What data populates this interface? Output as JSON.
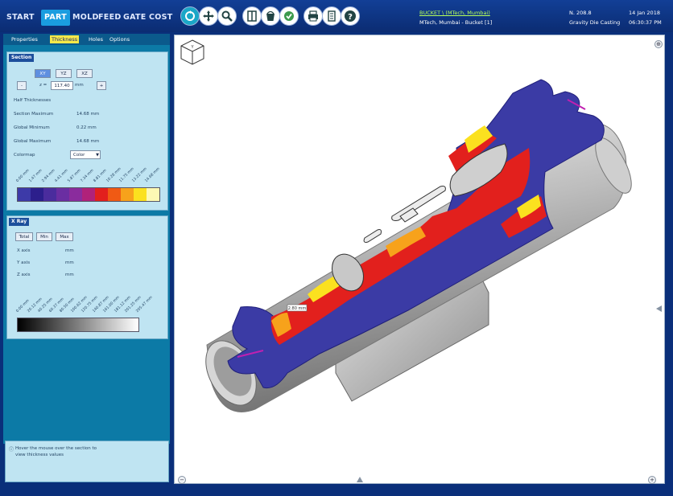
{
  "tabs": [
    {
      "id": "start",
      "label": "START"
    },
    {
      "id": "part",
      "label": "PART",
      "active": true
    },
    {
      "id": "mold",
      "label": "MOLD"
    },
    {
      "id": "feed",
      "label": "FEED"
    },
    {
      "id": "gate",
      "label": "GATE"
    },
    {
      "id": "cost",
      "label": "COST"
    }
  ],
  "toolbar": {
    "icons": [
      "rotate-icon",
      "pan-icon",
      "zoom-icon",
      "section-icon",
      "bucket-icon",
      "check-icon",
      "print-icon",
      "document-icon",
      "help-icon"
    ]
  },
  "header": {
    "project_link": "BUCKET \\ (MTech, Mumbai)",
    "project_sub": "MTech, Mumbai - Bucket [1]",
    "id_value": "N. 208.8",
    "date": "14 Jan 2018",
    "process": "Gravity Die Casting",
    "time": "06:30:37 PM"
  },
  "subtabs": [
    {
      "label": "Properties"
    },
    {
      "label": "Thickness",
      "active": true
    },
    {
      "label": "Holes"
    },
    {
      "label": "Options"
    }
  ],
  "section": {
    "title": "Section",
    "axes": [
      "XY",
      "YZ",
      "XZ"
    ],
    "minus": "-",
    "plus": "+",
    "z_label": "z =",
    "z_value": "117.40",
    "z_unit": "mm",
    "half_label": "Half Thicknesses",
    "rows": [
      {
        "label": "Section Maximum",
        "value": "14.68 mm"
      },
      {
        "label": "Global Minimum",
        "value": "0.22 mm"
      },
      {
        "label": "Global Maximum",
        "value": "14.68 mm"
      }
    ],
    "colormap_label": "Colormap",
    "colormap_value": "Color",
    "ticks": [
      "0.00 mm",
      "1.47 mm",
      "2.94 mm",
      "4.41 mm",
      "5.87 mm",
      "7.34 mm",
      "8.81 mm",
      "10.28 mm",
      "11.75 mm",
      "13.22 mm",
      "14.68 mm"
    ],
    "colors": [
      "#3d3aa8",
      "#2c1f8c",
      "#4a2c9d",
      "#6a2ea2",
      "#8a2c9d",
      "#b0227a",
      "#e2201d",
      "#f05a14",
      "#f7a21b",
      "#fbe11f",
      "#fdf9b4"
    ]
  },
  "xray": {
    "title": "X Ray",
    "buttons": [
      "Total",
      "Min",
      "Max"
    ],
    "rows": [
      {
        "label": "X axis",
        "value": "mm"
      },
      {
        "label": "Y axis",
        "value": "mm"
      },
      {
        "label": "Z axis",
        "value": "mm"
      }
    ],
    "ticks": [
      "0.00 mm",
      "20.12 mm",
      "40.25 mm",
      "60.37 mm",
      "80.50 mm",
      "100.62 mm",
      "120.75 mm",
      "140.87 mm",
      "161.00 mm",
      "181.12 mm",
      "201.25 mm",
      "205.47 mm"
    ]
  },
  "hint": "Hover the mouse over the section to view thickness values",
  "model": {
    "tooltip": "2.80 mm",
    "view_cube_label": "Y"
  }
}
